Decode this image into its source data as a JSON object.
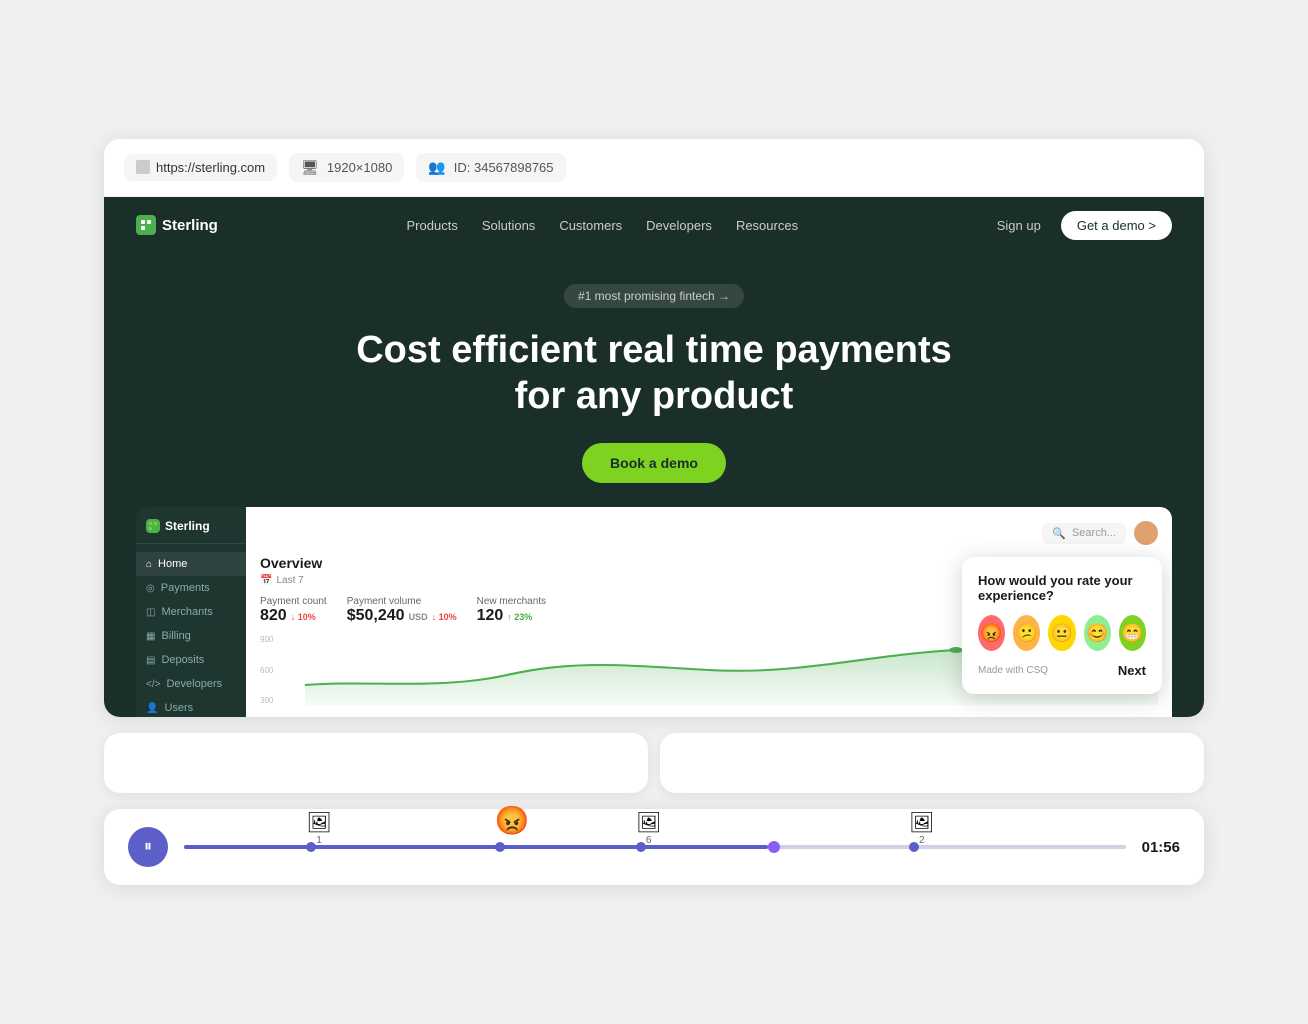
{
  "browser": {
    "url": "https://sterling.com",
    "resolution": "1920×1080",
    "user_id": "ID: 34567898765"
  },
  "sterling": {
    "logo": "Sterling",
    "nav": {
      "links": [
        "Products",
        "Solutions",
        "Customers",
        "Developers",
        "Resources"
      ],
      "sign_up": "Sign up",
      "demo_btn": "Get a demo >"
    },
    "hero": {
      "badge": "#1 most promising fintech →",
      "title": "Cost efficient real time payments for any product",
      "cta": "Book a demo"
    },
    "dashboard": {
      "sidebar": {
        "logo": "Sterling",
        "items": [
          "Home",
          "Payments",
          "Merchants",
          "Billing",
          "Deposits",
          "Developers",
          "Users"
        ]
      },
      "search_placeholder": "Search...",
      "overview": {
        "title": "Overview",
        "date_filter": "Last 7",
        "metrics": [
          {
            "label": "Payment count",
            "value": "820",
            "change": "↓ 10%",
            "type": "down"
          },
          {
            "label": "Payment volume",
            "value": "$50,240",
            "unit": "USD",
            "change": "↓ 10%",
            "type": "down"
          },
          {
            "label": "New merchants",
            "value": "120",
            "change": "↑ 23%",
            "type": "up"
          }
        ],
        "chart_labels": [
          "900",
          "600",
          "300"
        ]
      }
    },
    "rating_popup": {
      "question": "How would you rate your experience?",
      "emojis": [
        {
          "id": "very-bad",
          "emoji": "😡",
          "bg": "#ff6b6b"
        },
        {
          "id": "bad",
          "emoji": "😕",
          "bg": "#ffa07a"
        },
        {
          "id": "neutral",
          "emoji": "😐",
          "bg": "#ffd700"
        },
        {
          "id": "good",
          "emoji": "😊",
          "bg": "#90ee90"
        },
        {
          "id": "great",
          "emoji": "😁",
          "bg": "#7ed321"
        }
      ],
      "brand": "Made with CSQ",
      "next_btn": "Next"
    }
  },
  "timeline": {
    "play_icon": "⏸",
    "events": [
      {
        "label": "1",
        "icon": "🖼",
        "position_pct": 13
      },
      {
        "label": "",
        "icon": "😡",
        "position_pct": 33,
        "is_emoji": true
      },
      {
        "label": "6",
        "icon": "🖼",
        "position_pct": 48
      },
      {
        "label": "2",
        "icon": "🖼",
        "position_pct": 77
      }
    ],
    "current_position_pct": 62,
    "time": "01:56"
  }
}
